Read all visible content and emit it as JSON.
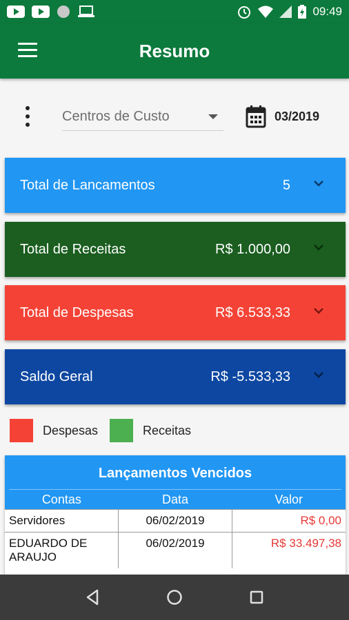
{
  "status_bar": {
    "time": "09:49",
    "left_icons": [
      "youtube-icon",
      "youtube-icon",
      "circle-icon",
      "laptop-icon"
    ],
    "right_icons": [
      "alarm-icon",
      "wifi-icon",
      "signal-icon",
      "battery-charging-icon"
    ]
  },
  "app_bar": {
    "title": "Resumo",
    "menu_icon": "hamburger-menu-icon",
    "color": "#0c7a3c"
  },
  "filters": {
    "cost_center_placeholder": "Centros de Custo",
    "date_value": "03/2019",
    "date_icon": "calendar-icon",
    "more_icon": "more-vert-icon"
  },
  "summary_cards": [
    {
      "label": "Total de Lancamentos",
      "value": "5",
      "color": "#2196f3"
    },
    {
      "label": "Total de Receitas",
      "value": "R$ 1.000,00",
      "color": "#1b5e20"
    },
    {
      "label": "Total de Despesas",
      "value": "R$ 6.533,33",
      "color": "#f44336"
    },
    {
      "label": "Saldo Geral",
      "value": "R$ -5.533,33",
      "color": "#0d47a1"
    }
  ],
  "legend": [
    {
      "label": "Despesas",
      "color": "#f44336"
    },
    {
      "label": "Receitas",
      "color": "#4caf50"
    }
  ],
  "overdue_table": {
    "title": "Lançamentos Vencidos",
    "columns": [
      "Contas",
      "Data",
      "Valor"
    ],
    "rows": [
      {
        "conta": "Servidores",
        "data": "06/02/2019",
        "valor": "R$ 0,00"
      },
      {
        "conta": "EDUARDO DE ARAUJO",
        "data": "06/02/2019",
        "valor": "R$ 33.497,38"
      }
    ],
    "header_color": "#2196f3",
    "value_color": "#e53935"
  },
  "nav_bar": {
    "icons": [
      "back-icon",
      "home-icon",
      "recents-icon"
    ]
  }
}
